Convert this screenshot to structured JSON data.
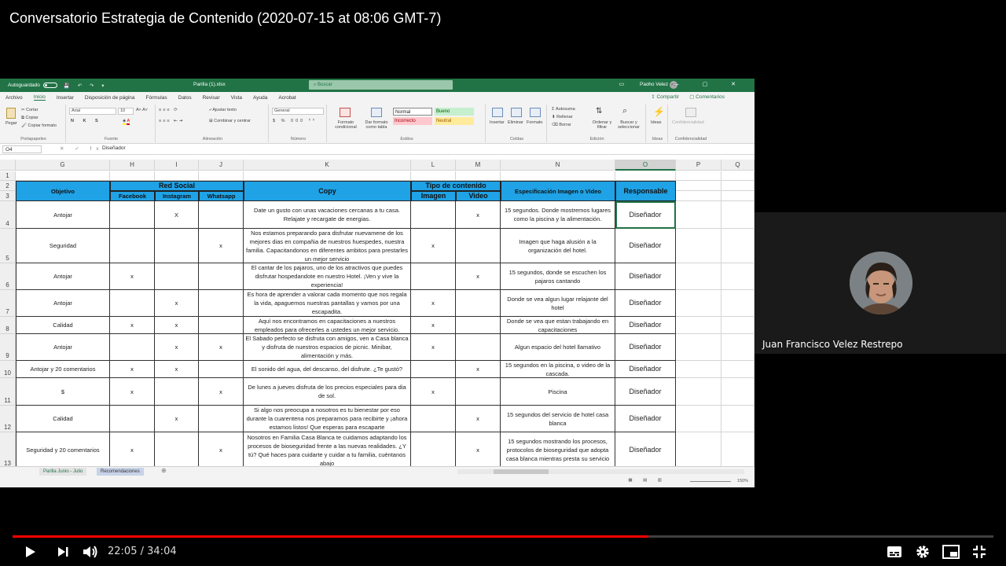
{
  "video": {
    "title": "Conversatorio Estrategia de Contenido (2020-07-15 at 08:06 GMT-7)",
    "current_time": "22:05",
    "time_separator": "/",
    "duration": "34:04",
    "progress_fraction": 0.648
  },
  "excel": {
    "autosave_label": "Autoguardado",
    "filename": "Parilla (1).xlsx",
    "search_placeholder": "Buscar",
    "user_name": "Pacho Velez",
    "user_initials": "PV",
    "menu": [
      "Archivo",
      "Inicio",
      "Insertar",
      "Disposición de página",
      "Fórmulas",
      "Datos",
      "Revisar",
      "Vista",
      "Ayuda",
      "Acrobat"
    ],
    "menu_active": "Inicio",
    "share_label": "Compartir",
    "comments_label": "Comentarios",
    "ribbon": {
      "clipboard": {
        "paste": "Pegar",
        "cut": "Cortar",
        "copy": "Copiar",
        "format_painter": "Copiar formato",
        "label": "Portapapeles"
      },
      "font": {
        "name": "Arial",
        "size": "10",
        "label": "Fuente"
      },
      "alignment": {
        "wrap": "Ajustar texto",
        "merge": "Combinar y centrar",
        "label": "Alineación"
      },
      "number": {
        "format": "General",
        "label": "Número"
      },
      "styles": {
        "conditional": "Formato condicional",
        "as_table": "Dar formato como tabla",
        "normal": "Normal",
        "bueno": "Bueno",
        "incorrecto": "Incorrecto",
        "neutral": "Neutral",
        "label": "Estilos"
      },
      "cells": {
        "insert": "Insertar",
        "delete": "Eliminar",
        "format": "Formato",
        "label": "Celdas"
      },
      "editing": {
        "autosum": "Autosuma",
        "fill": "Rellenar",
        "clear": "Borrar",
        "sort": "Ordenar y filtrar",
        "find": "Buscar y seleccionar",
        "label": "Edición"
      },
      "ideas": {
        "button": "Ideas",
        "label": "Ideas"
      },
      "sensitivity": {
        "button": "Confidencialidad",
        "label": "Confidencialidad"
      }
    },
    "name_box": "O4",
    "formula": "Diseñador",
    "columns": [
      "G",
      "H",
      "I",
      "J",
      "K",
      "L",
      "M",
      "N",
      "O",
      "P",
      "Q"
    ],
    "headers": {
      "objetivo": "Objetivo",
      "red_social": "Red Social",
      "facebook": "Facebook",
      "instagram": "Instagram",
      "whatsapp": "Whatsapp",
      "copy": "Copy",
      "tipo_contenido": "Tipo de contenido",
      "imagen": "Imagen",
      "video": "Video",
      "especificacion": "Especificación Imagen o Video",
      "responsable": "Responsable"
    },
    "rows": [
      {
        "num": "4",
        "objetivo": "Antojar",
        "facebook": "",
        "instagram": "X",
        "whatsapp": "",
        "copy": "Date un gusto con unas vacaciones cercanas a tu casa. Relajate y recargate de energias.",
        "imagen": "",
        "video": "x",
        "especificacion": "15 segundos. Donde mostremos lugares como la piscina y la alimentación.",
        "responsable": "Diseñador"
      },
      {
        "num": "5",
        "objetivo": "Seguridad",
        "facebook": "",
        "instagram": "",
        "whatsapp": "x",
        "copy": "Nos estamos preparando para disfrutar nuevamene de los mejores dias en compañia de nuestros huespedes, nuestra familia. Capacitandonos en diferentes ambitos para prestarles un mejor servicio",
        "imagen": "x",
        "video": "",
        "especificacion": "Imagen que haga alusión a la organización del hotel.",
        "responsable": "Diseñador"
      },
      {
        "num": "6",
        "objetivo": "Antojar",
        "facebook": "x",
        "instagram": "",
        "whatsapp": "",
        "copy": "El cantar de los pajaros, uno de los atractivos que puedes disfrutar hospedandote en nuestro Hotel. ¡Ven y vive la experiencia!",
        "imagen": "",
        "video": "x",
        "especificacion": "15 segundos, donde se escuchen los pajaros cantando",
        "responsable": "Diseñador"
      },
      {
        "num": "7",
        "objetivo": "Antojar",
        "facebook": "",
        "instagram": "x",
        "whatsapp": "",
        "copy": "Es hora de aprender a valorar cada momento que nos regala la vida, apaguemos nuestras pantallas y vamos por una escapadita.",
        "imagen": "x",
        "video": "",
        "especificacion": "Donde se vea algun lugar relajante del hotel",
        "responsable": "Diseñador"
      },
      {
        "num": "8",
        "objetivo": "Calidad",
        "facebook": "x",
        "instagram": "x",
        "whatsapp": "",
        "copy": "Aquí nos encontramos en capacitaciones a nuestros empleados para ofrecerles a ustedes un mejor servicio.",
        "imagen": "x",
        "video": "",
        "especificacion": "Donde se vea que estan trabajando en capacitaciones",
        "responsable": "Diseñador"
      },
      {
        "num": "9",
        "objetivo": "Antojar",
        "facebook": "",
        "instagram": "x",
        "whatsapp": "x",
        "copy": "El Sabado perfecto se disfruta con amigos, ven a Casa blanca y disfruta de nuestros espacios de picnic. Minibar, alimentación y más.",
        "imagen": "x",
        "video": "",
        "especificacion": "Algun espacio del hotel llamativo",
        "responsable": "Diseñador"
      },
      {
        "num": "10",
        "objetivo": "Antojar y 20 comentarios",
        "facebook": "x",
        "instagram": "x",
        "whatsapp": "",
        "copy": "El sonido del agua, del descanso, del disfrute. ¿Te gustó?",
        "imagen": "",
        "video": "x",
        "especificacion": "15 segundos en la piscina, o video de la cascada.",
        "responsable": "Diseñador"
      },
      {
        "num": "11",
        "objetivo": "$",
        "facebook": "x",
        "instagram": "",
        "whatsapp": "x",
        "copy": "De lunes a jueves disfruta de los precios especiales para dia de sol.",
        "imagen": "x",
        "video": "",
        "especificacion": "Piscina",
        "responsable": "Diseñador"
      },
      {
        "num": "12",
        "objetivo": "Calidad",
        "facebook": "",
        "instagram": "x",
        "whatsapp": "",
        "copy": "Si algo nos preocupa a nosotros es tu bienestar por eso durante la cuarentena nos preparamos para recibirte y ¡ahora estamos listos! Que esperas para escaparte",
        "imagen": "",
        "video": "x",
        "especificacion": "15 segundos del servicio de hotel casa blanca",
        "responsable": "Diseñador"
      },
      {
        "num": "13",
        "objetivo": "Seguridad y 20 comentarios",
        "facebook": "x",
        "instagram": "",
        "whatsapp": "x",
        "copy": "Nosotros en Familia Casa Blanca te cuidamos adaptando los procesos de bioseguridad frente a las nuevas realidades. ¿Y tú? Qué haces para cuidarte y cuidar a tu familia, cuéntanos abajo",
        "imagen": "",
        "video": "x",
        "especificacion": "15 segundos mostrando los procesos, protocolos de bioseguridad que adopta casa blanca mientras presta su servicio",
        "responsable": "Diseñador"
      }
    ],
    "sheet_tabs": [
      "Parilla Junio - Julio",
      "Recomendaciones"
    ],
    "zoom": "150%"
  },
  "participant": {
    "name": "Juan Francisco Velez Restrepo"
  }
}
